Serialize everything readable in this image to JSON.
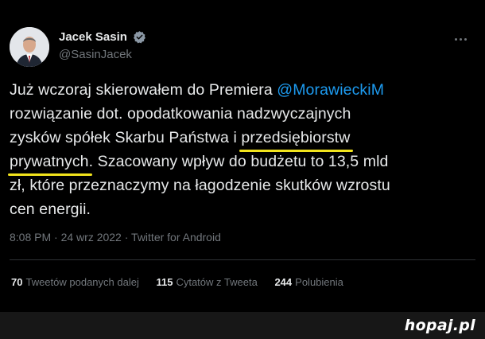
{
  "author": {
    "name": "Jacek Sasin",
    "handle": "@SasinJacek",
    "verified": true
  },
  "tweet": {
    "line1_a": "Już wczoraj skierowałem do Premiera ",
    "mention": "@MorawieckiM",
    "line2": "rozwiązanie dot. opodatkowania nadzwyczajnych",
    "line3_a": "zysków spółek Skarbu Państwa i ",
    "line3_hl": "przedsiębiorstw",
    "line4_hl": "prywatnych",
    "line4_b": ". Szacowany wpływ do budżetu to 13,5 mld",
    "line5": "zł, które przeznaczymy na łagodzenie skutków wzrostu",
    "line6": "cen energii."
  },
  "meta": "8:08 PM · 24 wrz 2022 · Twitter for Android",
  "stats": {
    "retweets_count": "70",
    "retweets_label": "Tweetów podanych dalej",
    "quotes_count": "115",
    "quotes_label": "Cytatów z Tweeta",
    "likes_count": "244",
    "likes_label": "Polubienia"
  },
  "watermark": "hopaj.pl",
  "colors": {
    "background": "#000000",
    "text": "#e7e9ea",
    "secondary": "#71767b",
    "mention": "#1d9bf0",
    "highlight_underline": "#f1e31c",
    "verified_badge": "#8b98a5"
  }
}
